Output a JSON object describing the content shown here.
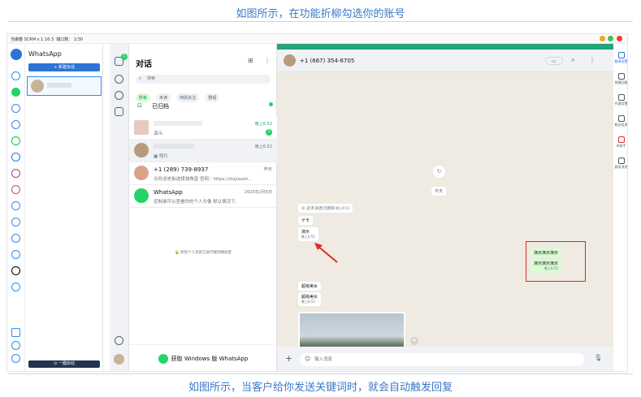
{
  "captions": {
    "top": "如图所示，在功能折柳勾选你的账号",
    "bottom": "如图所示，当客户给你发送关键词时，就会自动触发回复"
  },
  "window": {
    "title": "当傲春 SCRM v 1.16.3",
    "port": "端口数： 1/30"
  },
  "accounts": {
    "header": "WhatsApp",
    "new_session": "+ 新建会话",
    "one_key": "⊙ 一键启动"
  },
  "chatlist": {
    "title": "对话",
    "search_placeholder": "搜索",
    "filters": [
      "所有",
      "未读",
      "特别关注",
      "群组"
    ],
    "archived": "已归档",
    "unread_badge": "1",
    "rail_badge": "1",
    "chats": [
      {
        "name": "",
        "preview": "演示",
        "time": "晚上6:52",
        "unread": "1"
      },
      {
        "name": "",
        "preview": "照片",
        "time": "晚上6:52"
      },
      {
        "name": "+1 (289) 739-8937",
        "preview": "😍欢迎老板选择独角兽 官网：https://dujiaosh...",
        "time": "昨天"
      },
      {
        "name": "WhatsApp",
        "preview": "控制谁可以查看你的个人头像 默认情况下,",
        "time": "2025年2月6日"
      }
    ],
    "e2e_note": "你的个人消息已进行端到端加密",
    "get_windows": "获取 Windows 版 WhatsApp"
  },
  "conversation": {
    "phone": "+1 (667) 354-6705",
    "deleted_msg": "这条消息已删除",
    "deleted_time": "晚上6:51",
    "today_label": "今天",
    "incoming": [
      {
        "text": "ゲモ"
      },
      {
        "text": "演示",
        "time": "晚上6:51"
      },
      {
        "text": "超级美女"
      },
      {
        "text": "超级美女",
        "time": "晚上6:52"
      }
    ],
    "outgoing": [
      {
        "text": "演示演示演示"
      },
      {
        "text": "演示演示演示",
        "time": "晚上6:52"
      }
    ],
    "photo_time": "晚上6:52",
    "input_placeholder": "输入消息"
  },
  "right_sidebar": [
    {
      "label": "翻译设置"
    },
    {
      "label": "快捷回复"
    },
    {
      "label": "代理设置"
    },
    {
      "label": "粉丝信息"
    },
    {
      "label": "AI助手"
    },
    {
      "label": "群发消息"
    }
  ],
  "colors": {
    "accent": "#2d74d6",
    "whatsapp_green": "#25a474",
    "highlight_red": "#e02828"
  }
}
